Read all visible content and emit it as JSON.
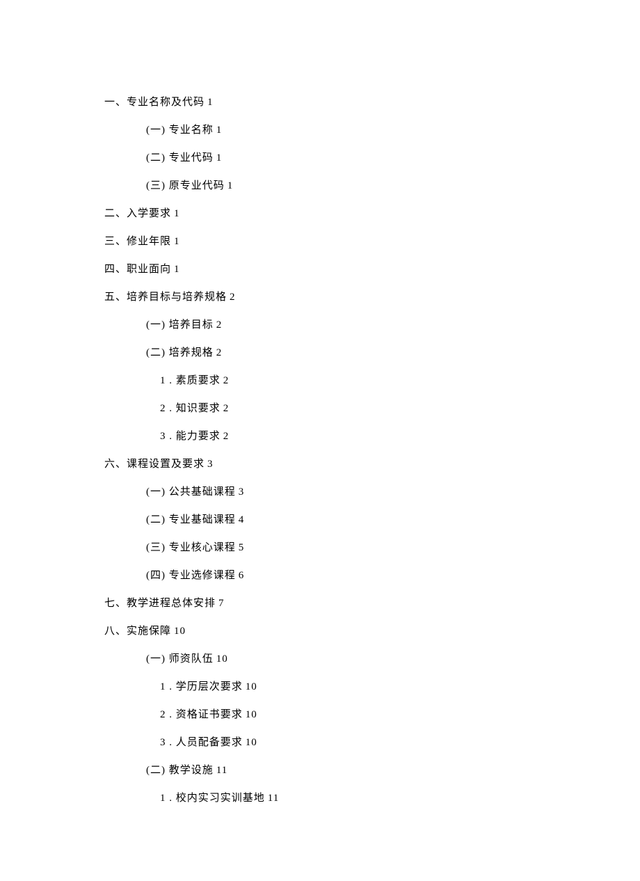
{
  "toc": [
    {
      "level": 1,
      "text": "一、专业名称及代码",
      "page": "1"
    },
    {
      "level": 2,
      "text": "(一) 专业名称",
      "page": "1"
    },
    {
      "level": 2,
      "text": "(二) 专业代码",
      "page": "1"
    },
    {
      "level": 2,
      "text": "(三) 原专业代码",
      "page": "1"
    },
    {
      "level": 1,
      "text": "二、入学要求",
      "page": "1"
    },
    {
      "level": 1,
      "text": "三、修业年限",
      "page": "1"
    },
    {
      "level": 1,
      "text": "四、职业面向",
      "page": "1"
    },
    {
      "level": 1,
      "text": "五、培养目标与培养规格",
      "page": "2"
    },
    {
      "level": 2,
      "text": "(一) 培养目标",
      "page": "2"
    },
    {
      "level": 2,
      "text": "(二) 培养规格",
      "page": "2"
    },
    {
      "level": 3,
      "text": "1 . 素质要求",
      "page": "2"
    },
    {
      "level": 3,
      "text": "2 . 知识要求",
      "page": "2"
    },
    {
      "level": 3,
      "text": "3 . 能力要求",
      "page": "2"
    },
    {
      "level": 1,
      "text": "六、课程设置及要求",
      "page": "3"
    },
    {
      "level": 2,
      "text": "(一) 公共基础课程",
      "page": "3"
    },
    {
      "level": 2,
      "text": "(二) 专业基础课程",
      "page": "4"
    },
    {
      "level": 2,
      "text": "(三) 专业核心课程",
      "page": "5"
    },
    {
      "level": 2,
      "text": "(四) 专业选修课程",
      "page": "6"
    },
    {
      "level": 1,
      "text": "七、教学进程总体安排",
      "page": "7"
    },
    {
      "level": 1,
      "text": "八、实施保障",
      "page": "10"
    },
    {
      "level": 2,
      "text": "(一) 师资队伍",
      "page": "10"
    },
    {
      "level": 3,
      "text": "1 . 学历层次要求",
      "page": "10"
    },
    {
      "level": 3,
      "text": "2 . 资格证书要求",
      "page": "10"
    },
    {
      "level": 3,
      "text": "3 . 人员配备要求",
      "page": "10"
    },
    {
      "level": 2,
      "text": "(二) 教学设施",
      "page": "11"
    },
    {
      "level": 3,
      "text": "1 . 校内实习实训基地",
      "page": "11"
    }
  ]
}
